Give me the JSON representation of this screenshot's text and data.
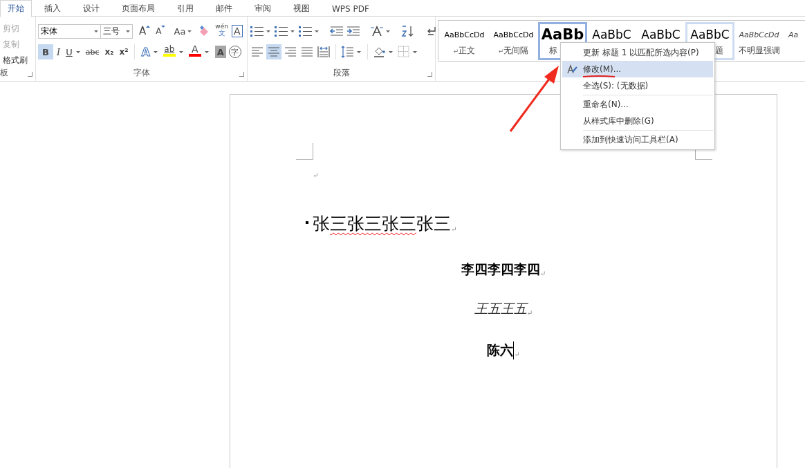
{
  "tabs": [
    {
      "label": "开始",
      "selected": true
    },
    {
      "label": "插入",
      "selected": false
    },
    {
      "label": "设计",
      "selected": false
    },
    {
      "label": "页面布局",
      "selected": false
    },
    {
      "label": "引用",
      "selected": false
    },
    {
      "label": "邮件",
      "selected": false
    },
    {
      "label": "审阅",
      "selected": false
    },
    {
      "label": "视图",
      "selected": false
    },
    {
      "label": "WPS PDF",
      "selected": false
    }
  ],
  "clipboard": {
    "items": [
      {
        "label": "剪切",
        "disabled": true
      },
      {
        "label": "复制",
        "disabled": true
      },
      {
        "label": "格式刷",
        "disabled": false
      }
    ],
    "group_label": "板"
  },
  "font": {
    "font_name": "宋体",
    "font_size": "三号",
    "group_label": "字体",
    "row1": [
      {
        "kind": "grow",
        "label": "A"
      },
      {
        "kind": "shrink",
        "label": "A"
      },
      {
        "kind": "case",
        "label": "Aa"
      },
      {
        "kind": "clear"
      },
      {
        "kind": "phonetic",
        "label": "wén",
        "sub": "文"
      },
      {
        "kind": "border",
        "label": "A"
      }
    ],
    "row2": [
      {
        "kind": "bold",
        "label": "B",
        "selected": true
      },
      {
        "kind": "italic",
        "label": "I",
        "selected": false
      },
      {
        "kind": "underline",
        "label": "U",
        "selected": false
      },
      {
        "kind": "strike",
        "label": "abc",
        "selected": false
      },
      {
        "kind": "subscript",
        "label": "x₂",
        "selected": false
      },
      {
        "kind": "superscript",
        "label": "x²",
        "selected": false
      },
      {
        "kind": "effect",
        "label": "A",
        "selected": false
      },
      {
        "kind": "highlight",
        "label": "ab",
        "color": "#ffff00",
        "selected": false
      },
      {
        "kind": "fontcolor",
        "label": "A",
        "color": "#ff0000",
        "selected": false
      },
      {
        "kind": "shading",
        "label": "A",
        "selected": false
      },
      {
        "kind": "enclose",
        "label": "字",
        "selected": false
      }
    ]
  },
  "paragraph": {
    "group_label": "段落",
    "row1": [
      {
        "kind": "bullets",
        "dropdown": true
      },
      {
        "kind": "numbering",
        "dropdown": true
      },
      {
        "kind": "multilevel",
        "dropdown": true
      },
      {
        "kind": "outdent",
        "dropdown": false
      },
      {
        "kind": "indent",
        "dropdown": false
      },
      {
        "kind": "asian",
        "dropdown": true
      },
      {
        "kind": "sort",
        "dropdown": false
      },
      {
        "kind": "marks",
        "dropdown": false
      }
    ],
    "row2": [
      {
        "kind": "left",
        "dropdown": false,
        "selected": false
      },
      {
        "kind": "center",
        "dropdown": false,
        "selected": true
      },
      {
        "kind": "right",
        "dropdown": false,
        "selected": false
      },
      {
        "kind": "justify",
        "dropdown": false,
        "selected": false
      },
      {
        "kind": "distribute",
        "dropdown": false,
        "selected": false
      },
      {
        "kind": "spacing",
        "dropdown": true,
        "selected": false
      },
      {
        "kind": "shading",
        "dropdown": true,
        "selected": false
      },
      {
        "kind": "borders",
        "dropdown": true,
        "selected": false
      }
    ]
  },
  "styles": [
    {
      "kind": "normal",
      "preview": "AaBbCcDd",
      "mark": "↵",
      "label": "正文",
      "selected": false,
      "hover": false
    },
    {
      "kind": "normal",
      "preview": "AaBbCcDd",
      "mark": "↵",
      "label": "无间隔",
      "selected": false,
      "hover": false
    },
    {
      "kind": "heading1",
      "preview": "AaBb",
      "label": "标",
      "selected": true,
      "hover": false
    },
    {
      "kind": "heading2",
      "preview": "AaBbC",
      "selected": false,
      "hover": false
    },
    {
      "kind": "heading2",
      "preview": "AaBbC",
      "selected": false,
      "hover": false
    },
    {
      "kind": "title",
      "preview": "AaBbC",
      "label": "题",
      "selected": false,
      "hover": true
    },
    {
      "kind": "emphasis",
      "preview": "AaBbCcDd",
      "label": "不明显强调",
      "selected": false,
      "hover": false
    },
    {
      "kind": "emphasis",
      "preview": "Aa",
      "selected": false,
      "hover": false
    }
  ],
  "context_menu": {
    "items": [
      {
        "kind": "item",
        "label": "更新 标题 1 以匹配所选内容(P)",
        "highlighted": false,
        "icon": false
      },
      {
        "kind": "item",
        "label": "修改(M)...",
        "highlighted": true,
        "icon": true
      },
      {
        "kind": "item",
        "label": "全选(S): (无数据)",
        "highlighted": false,
        "icon": false
      },
      {
        "kind": "separator"
      },
      {
        "kind": "item",
        "label": "重命名(N)...",
        "highlighted": false,
        "icon": false
      },
      {
        "kind": "item",
        "label": "从样式库中删除(G)",
        "highlighted": false,
        "icon": false
      },
      {
        "kind": "separator"
      },
      {
        "kind": "item",
        "label": "添加到快速访问工具栏(A)",
        "highlighted": false,
        "icon": false
      }
    ]
  },
  "document": {
    "paragraphs": [
      {
        "kind": "empty",
        "mark": "↵",
        "cursor": false
      },
      {
        "kind": "heading1",
        "runs": [
          {
            "text": "张",
            "spell_error": false
          },
          {
            "text": "三张三张三",
            "spell_error": true
          },
          {
            "text": "张三",
            "spell_error": false
          }
        ],
        "mark": "↵",
        "cursor": false
      },
      {
        "kind": "bold",
        "runs": [
          {
            "text": "李四李四李四",
            "spell_error": false
          }
        ],
        "mark": "↵",
        "cursor": false
      },
      {
        "kind": "italic",
        "runs": [
          {
            "text": "王五王五",
            "spell_error": false
          }
        ],
        "mark": "↵",
        "cursor": false
      },
      {
        "kind": "bold",
        "runs": [
          {
            "text": "陈六",
            "spell_error": false
          }
        ],
        "mark": "↵",
        "cursor": true
      }
    ]
  }
}
